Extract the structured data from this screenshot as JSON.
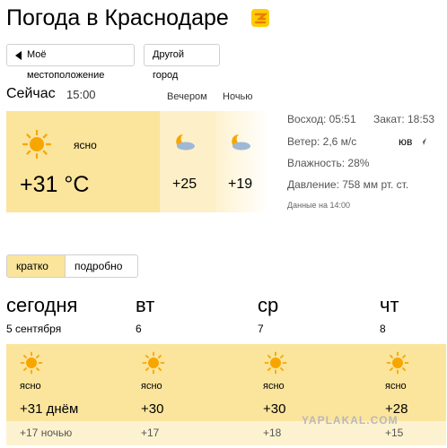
{
  "header": {
    "title": "Погода в Краснодаре"
  },
  "buttons": {
    "my_location": "Моё местоположение",
    "other_city": "Другой город"
  },
  "now": {
    "label": "Сейчас",
    "time": "15:00",
    "evening_label": "Вечером",
    "night_label": "Ночью",
    "condition": "ясно",
    "temperature": "+31 °C",
    "evening_temp": "+25",
    "night_temp": "+19"
  },
  "details": {
    "sunrise": "Восход: 05:51",
    "sunset": "Закат: 18:53",
    "wind": "Ветер: 2,6 м/с",
    "wind_dir": "юв",
    "humidity": "Влажность: 28%",
    "pressure": "Давление: 758 мм рт. ст.",
    "updated": "Данные на 14:00"
  },
  "tabs": {
    "brief": "кратко",
    "detailed": "подробно"
  },
  "forecast": [
    {
      "day": "сегодня",
      "date": "5 сентября",
      "condition": "ясно",
      "high": "+31 днём",
      "low": "+17 ночью"
    },
    {
      "day": "вт",
      "date": "6",
      "condition": "ясно",
      "high": "+30",
      "low": "+17"
    },
    {
      "day": "ср",
      "date": "7",
      "condition": "ясно",
      "high": "+30",
      "low": "+18"
    },
    {
      "day": "чт",
      "date": "8",
      "condition": "ясно",
      "high": "+28",
      "low": "+15"
    }
  ],
  "watermark": "YAPLAKAL.COM",
  "colors": {
    "accent": "#fbe49c",
    "accent_light": "#fdf2d0",
    "sun": "#f7a600"
  },
  "icons": {
    "logo": "yandex-weather-logo-icon",
    "sun": "sun-icon",
    "moon": "moon-cloud-icon",
    "location": "location-arrow-icon",
    "wind": "wind-direction-icon"
  }
}
